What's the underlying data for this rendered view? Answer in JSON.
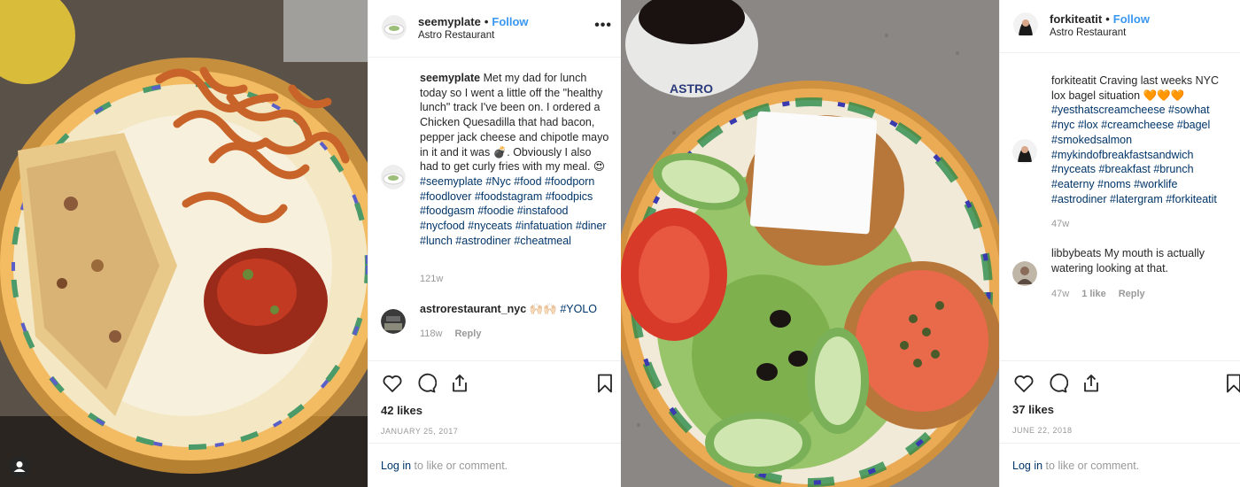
{
  "post1": {
    "username": "seemyplate",
    "follow_label": "Follow",
    "location": "Astro Restaurant",
    "caption_user": "seemyplate",
    "caption_text": "Met my dad for lunch today so I went a little off the \"healthy lunch\" track I've been on. I ordered a Chicken Quesadilla that had bacon, pepper jack cheese and chipotle mayo in it and it was 💣. Obviously I also had to get curly fries with my meal. 😍",
    "caption_tags": "#seemyplate #Nyc #food #foodporn #foodlover #foodstagram #foodpics #foodgasm #foodie #instafood #nycfood #nyceats #infatuation #diner #lunch #astrodiner #cheatmeal",
    "caption_time": "121w",
    "reply_user": "astrorestaurant_nyc",
    "reply_text": "🙌🏻🙌🏻",
    "reply_tag": "#YOLO",
    "reply_time": "118w",
    "reply_action": "Reply",
    "likes": "42 likes",
    "date": "JANUARY 25, 2017",
    "login_link": "Log in",
    "login_rest": "to like or comment."
  },
  "post2": {
    "username": "forkiteatit",
    "follow_label": "Follow",
    "location": "Astro Restaurant",
    "caption_user": "forkiteatit",
    "caption_text": "Craving last weeks NYC lox bagel situation 🧡🧡🧡",
    "caption_tags": "#yesthatscreamcheese #sowhat #nyc #lox #creamcheese #bagel #smokedsalmon #mykindofbreakfastsandwich #nyceats #breakfast #brunch #eaterny #noms #worklife #astrodiner #latergram #forkiteatit",
    "caption_time": "47w",
    "comment_user": "libbybeats",
    "comment_text": "My mouth is actually watering looking at that.",
    "comment_time": "47w",
    "comment_likes": "1 like",
    "comment_action": "Reply",
    "likes": "37 likes",
    "date": "JUNE 22, 2018",
    "login_link": "Log in",
    "login_rest": "to like or comment."
  },
  "icons": {
    "like": "heart-icon",
    "comment": "comment-icon",
    "share": "share-icon",
    "save": "bookmark-icon",
    "more": "more-options-icon",
    "corner": "user-tag-icon"
  },
  "colors": {
    "link_blue": "#3897f0",
    "hashtag": "#003569",
    "muted": "#999999",
    "text": "#262626"
  }
}
